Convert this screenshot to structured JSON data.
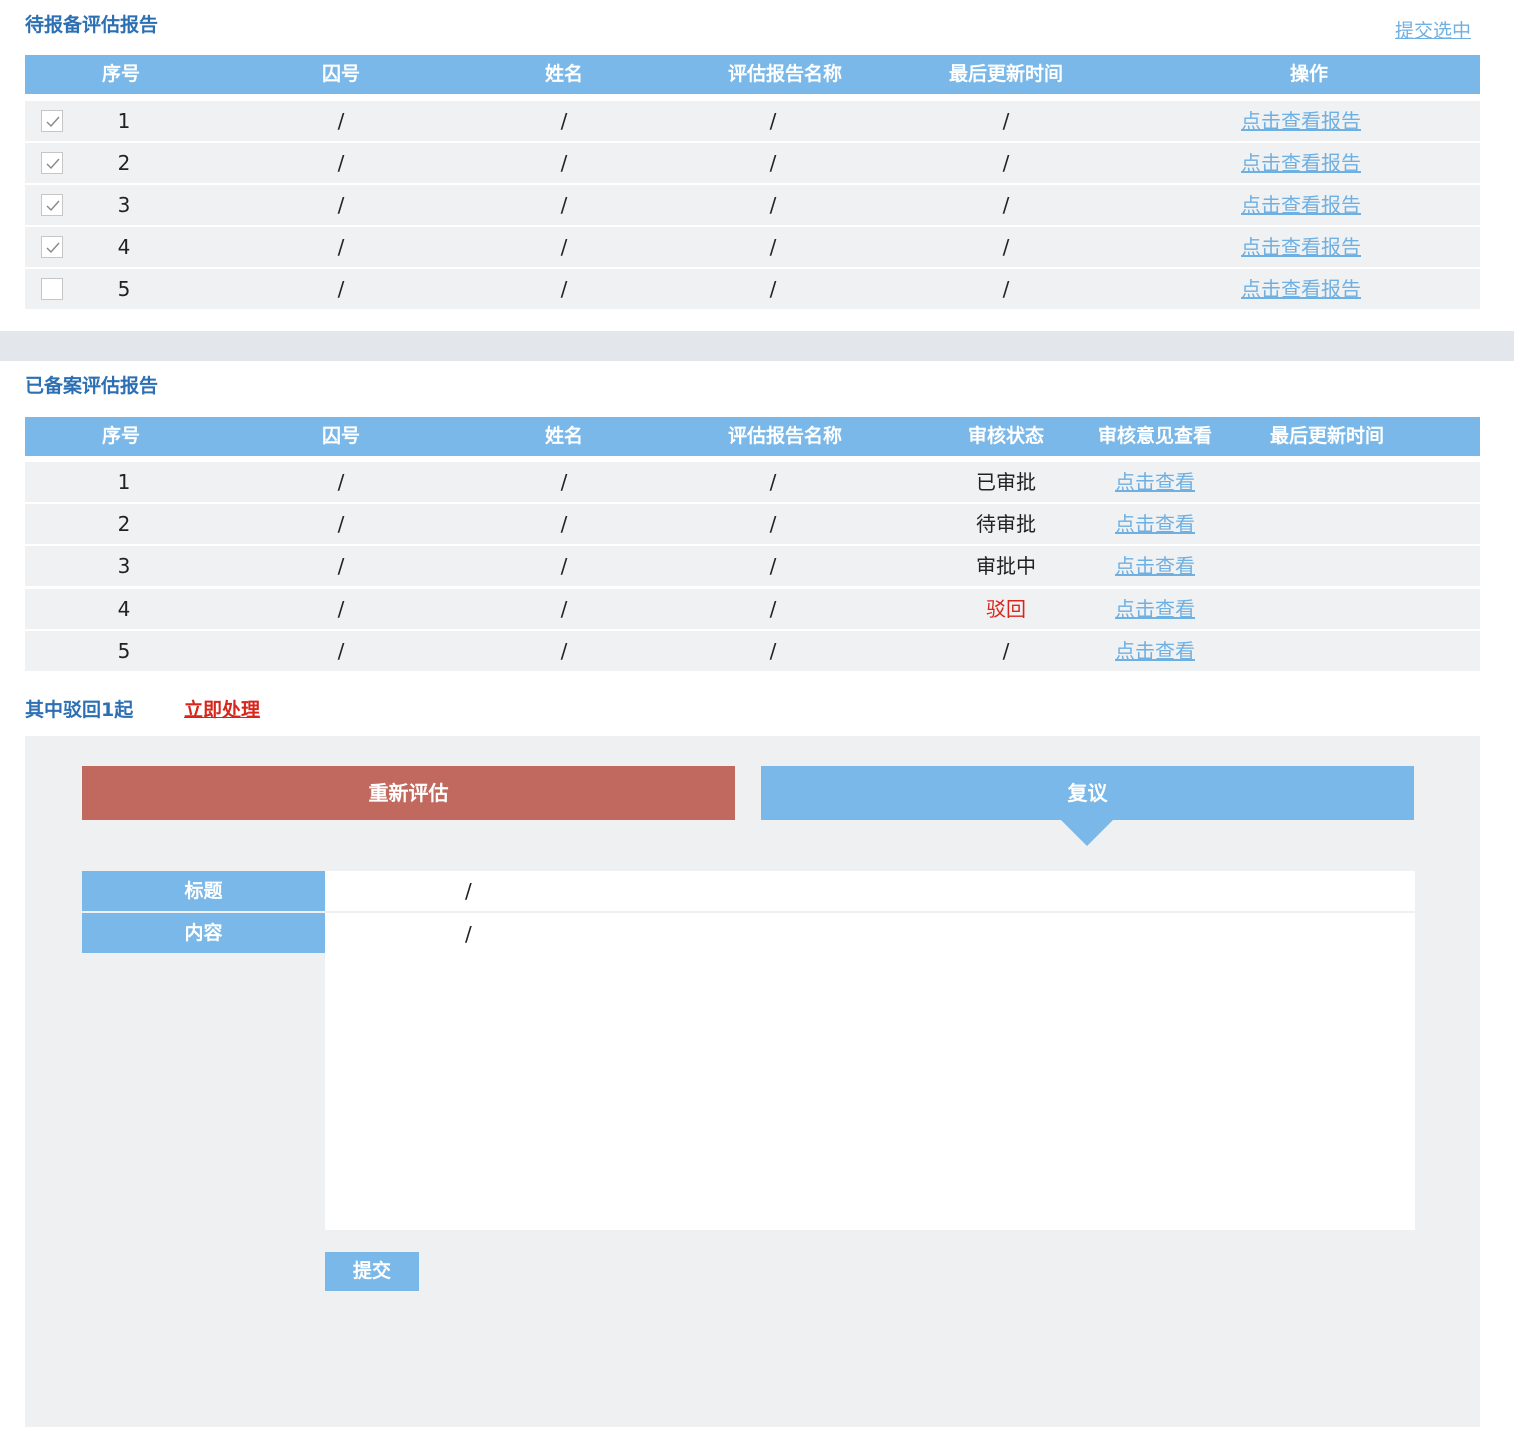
{
  "pending": {
    "title": "待报备评估报告",
    "submit_selected": "提交选中",
    "headers": {
      "seq": "序号",
      "prisoner_no": "囚号",
      "name": "姓名",
      "report_name": "评估报告名称",
      "updated": "最后更新时间",
      "action": "操作"
    },
    "rows": [
      {
        "checked": true,
        "seq": "1",
        "prisoner_no": "/",
        "name": "/",
        "report_name": "/",
        "updated": "/",
        "action": "点击查看报告"
      },
      {
        "checked": true,
        "seq": "2",
        "prisoner_no": "/",
        "name": "/",
        "report_name": "/",
        "updated": "/",
        "action": "点击查看报告"
      },
      {
        "checked": true,
        "seq": "3",
        "prisoner_no": "/",
        "name": "/",
        "report_name": "/",
        "updated": "/",
        "action": "点击查看报告"
      },
      {
        "checked": true,
        "seq": "4",
        "prisoner_no": "/",
        "name": "/",
        "report_name": "/",
        "updated": "/",
        "action": "点击查看报告"
      },
      {
        "checked": false,
        "seq": "5",
        "prisoner_no": "/",
        "name": "/",
        "report_name": "/",
        "updated": "/",
        "action": "点击查看报告"
      }
    ]
  },
  "filed": {
    "title": "已备案评估报告",
    "headers": {
      "seq": "序号",
      "prisoner_no": "囚号",
      "name": "姓名",
      "report_name": "评估报告名称",
      "status": "审核状态",
      "opinion": "审核意见查看",
      "updated": "最后更新时间"
    },
    "rows": [
      {
        "seq": "1",
        "prisoner_no": "/",
        "name": "/",
        "report_name": "/",
        "status": "已审批",
        "status_color": "#222222",
        "opinion": "点击查看"
      },
      {
        "seq": "2",
        "prisoner_no": "/",
        "name": "/",
        "report_name": "/",
        "status": "待审批",
        "status_color": "#222222",
        "opinion": "点击查看"
      },
      {
        "seq": "3",
        "prisoner_no": "/",
        "name": "/",
        "report_name": "/",
        "status": "审批中",
        "status_color": "#222222",
        "opinion": "点击查看"
      },
      {
        "seq": "4",
        "prisoner_no": "/",
        "name": "/",
        "report_name": "/",
        "status": "驳回",
        "status_color": "#d9261c",
        "opinion": "点击查看"
      },
      {
        "seq": "5",
        "prisoner_no": "/",
        "name": "/",
        "report_name": "/",
        "status": "/",
        "status_color": "#222222",
        "opinion": "点击查看"
      }
    ]
  },
  "notice": {
    "text": "其中驳回1起",
    "action": "立即处理"
  },
  "process": {
    "reassess_label": "重新评估",
    "reconsider_label": "复议",
    "reassess_color": "#c1695e",
    "reconsider_color": "#79b8e8",
    "form": {
      "title_label": "标题",
      "title_value": "/",
      "content_label": "内容",
      "content_value": "/",
      "submit_label": "提交"
    }
  },
  "colors": {
    "header_bg": "#79b8e8",
    "title_text": "#2c6fb3",
    "link": "#6fb0e3",
    "row_bg": "#f0f1f2",
    "rejected": "#d9261c"
  }
}
